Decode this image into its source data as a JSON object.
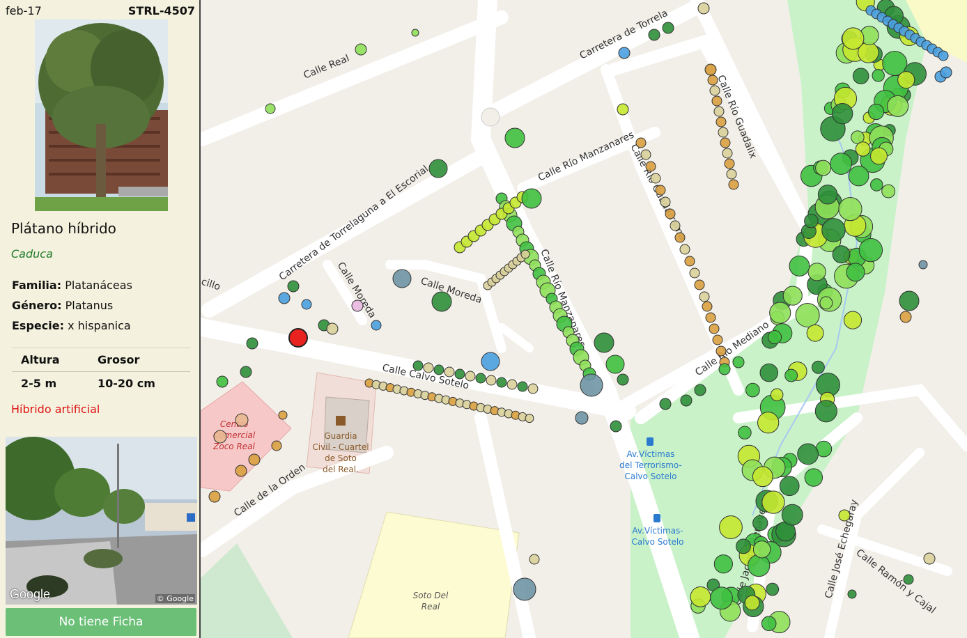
{
  "tree": {
    "date": "feb-17",
    "code": "STRL-4507",
    "common_name": "Plátano híbrido",
    "leaf_type": "Caduca",
    "familia_label": "Familia:",
    "familia": "Platanáceas",
    "genero_label": "Género:",
    "genero": "Platanus",
    "especie_label": "Especie:",
    "especie": "x hispanica",
    "altura_label": "Altura",
    "altura": "2-5 m",
    "grosor_label": "Grosor",
    "grosor": "10-20 cm",
    "origin_note": "Híbrido artificial",
    "google_brand": "Google",
    "google_copy": "© Google",
    "button_label": "No tiene Ficha"
  },
  "map": {
    "streets": {
      "calle_real": "Calle Real",
      "carretera_torrelaguna_escorial": "Carretera de Torrelaguna a El Escorial",
      "carretera_torrela": "Carretera de Torrela",
      "calle_rio_manzanares": "Calle Río Manzanares",
      "calle_rio_guadalix": "Calle Río Guadalix",
      "calle_rio_guadarrama": "Calle Río Guadarrama",
      "calle_moreda_vertical": "Calle Moreda",
      "calle_moreda": "Calle Moreda",
      "calle_rio_manzanares_2": "Calle Río Manzanares",
      "calle_rio_mediano": "Calle Río Mediano",
      "calle_calvo_sotelo": "Calle Calvo Sotelo",
      "calle_de_la_orden": "Calle de la Orden",
      "calle_jacinto_benavente": "Calle Jacinto Benavente",
      "calle_jose_echegaray": "Calle José Echegaray",
      "calle_ramon_y_cajal": "Calle Ramón y Cajal",
      "calle_cillo": "cillo"
    },
    "pois": {
      "centro_comercial_1": "Centro",
      "centro_comercial_2": "Comercial",
      "centro_comercial_3": "Zoco Real",
      "guardia_1": "Guardia",
      "guardia_2": "Civil - Cuartel",
      "guardia_3": "de Soto",
      "guardia_4": "del Real.",
      "bus1_1": "Av.Víctimas",
      "bus1_2": "del Terrorismo-",
      "bus1_3": "Calvo Sotelo",
      "bus2_1": "Av.Víctimas-",
      "bus2_2": "Calvo Sotelo",
      "soto_1": "Soto Del",
      "soto_2": "Real"
    },
    "selected_tree_color": "#e8221e",
    "tree_colors": [
      "#2f8f3a",
      "#40c040",
      "#8fe05a",
      "#c5e830",
      "#d9d09a",
      "#d9a040",
      "#e8b890",
      "#4aa0e0",
      "#6f95a5",
      "#e8b8e0"
    ]
  }
}
